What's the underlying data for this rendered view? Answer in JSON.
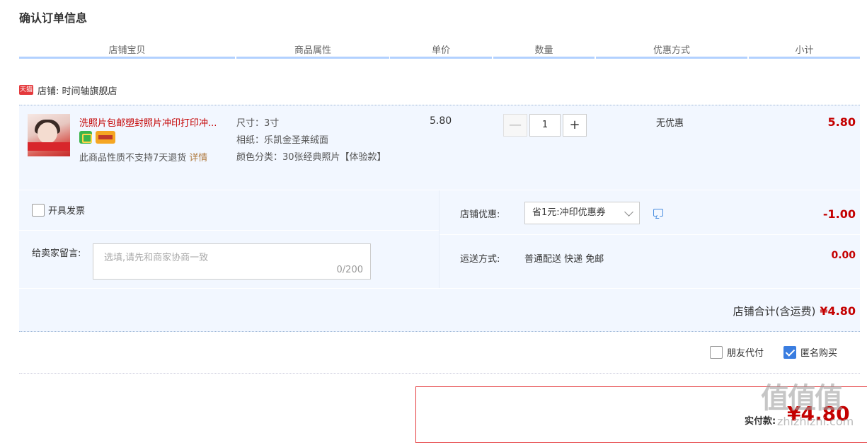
{
  "page_title": "确认订单信息",
  "columns": [
    "店铺宝贝",
    "商品属性",
    "单价",
    "数量",
    "优惠方式",
    "小计"
  ],
  "shop": {
    "icon_label": "天猫",
    "label": "店铺: 时间轴旗舰店"
  },
  "item": {
    "name": "洗照片包邮塑封照片冲印打印冲...",
    "no_return_text": "此商品性质不支持7天退货",
    "detail_link": "详情",
    "attrs": [
      "尺寸：3寸",
      "相纸：乐凯金圣莱绒面",
      "颜色分类：30张经典照片【体验款】"
    ],
    "unit_price": "5.80",
    "quantity": "1",
    "minus_label": "—",
    "plus_label": "+",
    "promo": "无优惠",
    "subtotal": "5.80"
  },
  "options": {
    "invoice_label": "开具发票",
    "message_label": "给卖家留言:",
    "message_placeholder": "选填,请先和商家协商一致",
    "message_count": "0/200",
    "discount_label": "店铺优惠:",
    "discount_value": "省1元:冲印优惠券",
    "discount_amount": "-1.00",
    "shipping_label": "运送方式:",
    "shipping_value": "普通配送 快递 免邮",
    "shipping_amount": "0.00",
    "shop_total_label": "店铺合计(含运费)",
    "shop_total_amount": "¥4.80"
  },
  "extras": {
    "friend_pay_label": "朋友代付",
    "anonymous_label": "匿名购买"
  },
  "payment": {
    "label": "实付款:",
    "amount": "¥4.80"
  },
  "watermark": {
    "main": "值值值",
    "sub": "zhizhizhi.com"
  },
  "colors": {
    "accent_red": "#c40000",
    "header_line": "#b2d1ff",
    "panel_bg": "#f2f7ff",
    "checkbox_blue": "#3a7de0"
  }
}
